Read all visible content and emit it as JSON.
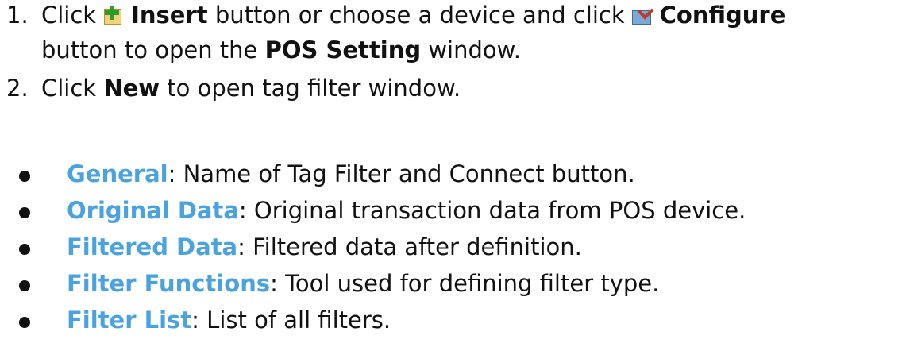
{
  "steps": [
    {
      "number": "1.",
      "pre": "Click",
      "insert_label": "Insert",
      "mid": "button or choose a device and click",
      "configure_label": "Configure",
      "line2_pre": "button to open the",
      "pos_setting": "POS Setting",
      "line2_post": "window."
    },
    {
      "number": "2.",
      "pre": "Click",
      "new_label": "New",
      "post": "to open tag filter window."
    }
  ],
  "icons": {
    "insert": "insert-icon",
    "configure": "configure-icon"
  },
  "bullets": [
    {
      "term": "General",
      "desc": ": Name of Tag Filter and Connect button."
    },
    {
      "term": "Original Data",
      "desc": ": Original transaction data from POS device."
    },
    {
      "term": "Filtered Data",
      "desc": ": Filtered data after definition."
    },
    {
      "term": "Filter Functions",
      "desc": ": Tool used for defining filter type."
    },
    {
      "term": "Filter List",
      "desc": ": List of all filters."
    }
  ],
  "colors": {
    "term": "#4aa3df",
    "text": "#111111"
  }
}
